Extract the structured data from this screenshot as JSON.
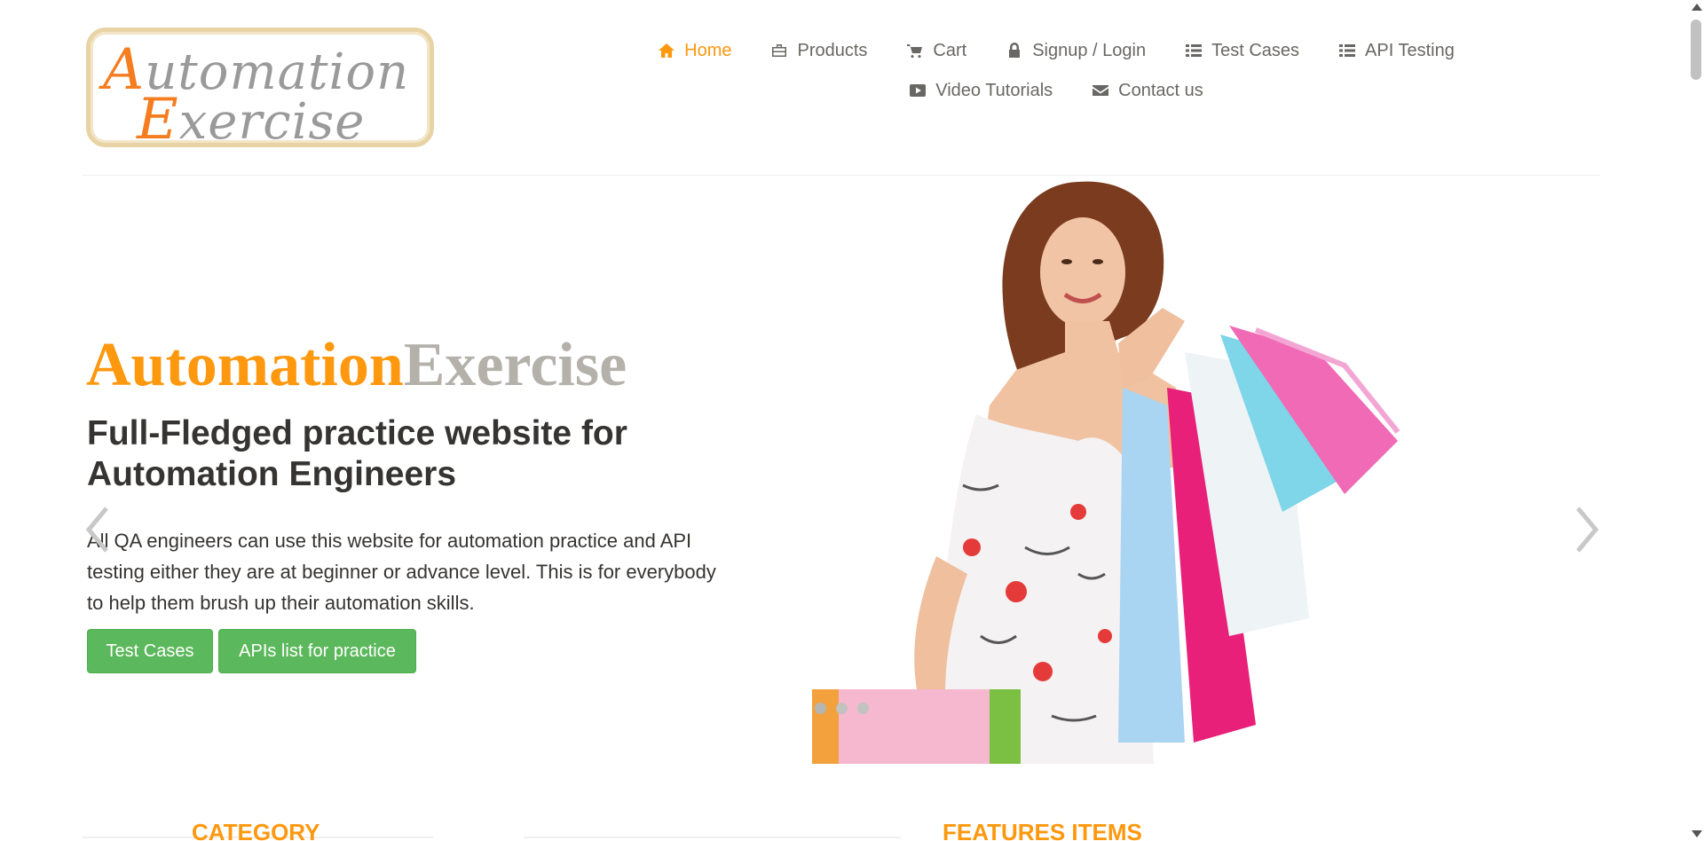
{
  "logo": {
    "line1_cap": "A",
    "line1_rest": "utomation",
    "line2_cap": "E",
    "line2_rest": "xercise"
  },
  "nav": {
    "row1": [
      {
        "label": "Home",
        "icon": "home-icon",
        "active": true
      },
      {
        "label": "Products",
        "icon": "briefcase-icon"
      },
      {
        "label": "Cart",
        "icon": "cart-icon"
      },
      {
        "label": "Signup / Login",
        "icon": "lock-icon"
      },
      {
        "label": "Test Cases",
        "icon": "list-icon"
      },
      {
        "label": "API Testing",
        "icon": "list-icon"
      }
    ],
    "row2": [
      {
        "label": "Video Tutorials",
        "icon": "youtube-play-icon"
      },
      {
        "label": "Contact us",
        "icon": "envelope-icon"
      }
    ]
  },
  "hero": {
    "title_a": "Automation",
    "title_b": "Exercise",
    "subtitle": "Full-Fledged practice website for Automation Engineers",
    "text": "All QA engineers can use this website for automation practice and API testing either they are at beginner or advance level. This is for everybody to help them brush up their automation skills.",
    "btn_test_cases": "Test Cases",
    "btn_apis": "APIs list for practice"
  },
  "sections": {
    "category": "CATEGORY",
    "features": "FEATURES ITEMS"
  },
  "colors": {
    "accent": "#fe980f",
    "button": "#5cb85c",
    "text": "#696763",
    "dark": "#363432"
  }
}
